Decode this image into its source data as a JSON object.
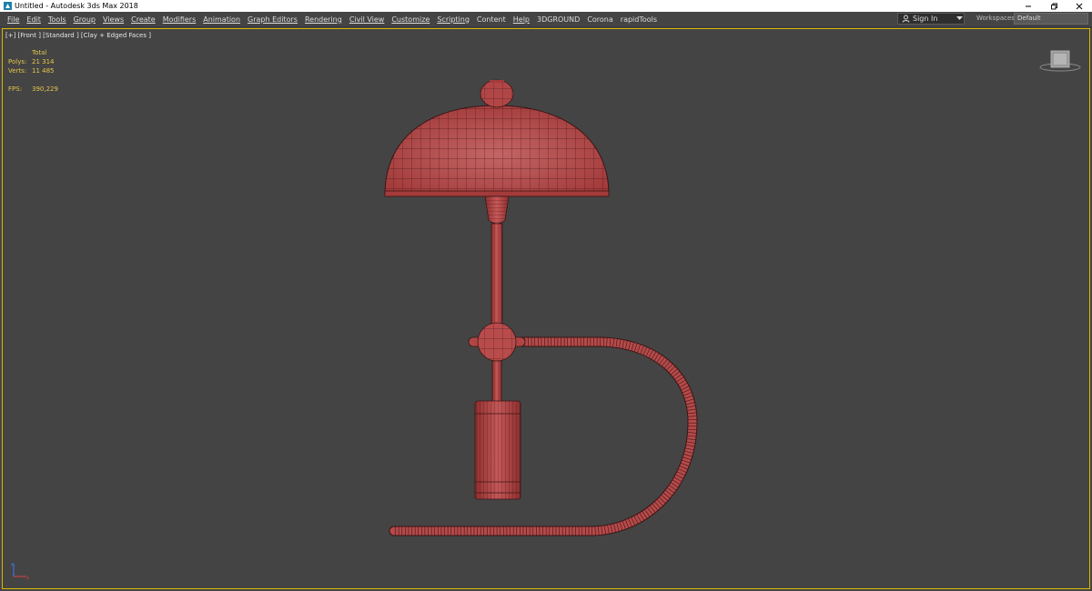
{
  "window": {
    "title": "Untitled - Autodesk 3ds Max 2018"
  },
  "menu": {
    "items": [
      "File",
      "Edit",
      "Tools",
      "Group",
      "Views",
      "Create",
      "Modifiers",
      "Animation",
      "Graph Editors",
      "Rendering",
      "Civil View",
      "Customize",
      "Scripting",
      "Content",
      "Help",
      "3DGROUND",
      "Corona",
      "rapidTools"
    ]
  },
  "signin": {
    "label": "Sign In"
  },
  "workspaces": {
    "label": "Workspaces:",
    "value": "Default"
  },
  "viewport": {
    "label": "[+] [Front ] [Standard ] [Clay + Edged Faces ]",
    "stats": {
      "total_label": "Total",
      "polys_label": "Polys:",
      "polys_value": "21 314",
      "verts_label": "Verts:",
      "verts_value": "11 485",
      "fps_label": "FPS:",
      "fps_value": "390,229"
    }
  },
  "colors": {
    "model": "#b84545",
    "wire": "#3c1414",
    "viewport_border": "#d9b800",
    "stats_text": "#e5c64a",
    "background": "#444444"
  }
}
